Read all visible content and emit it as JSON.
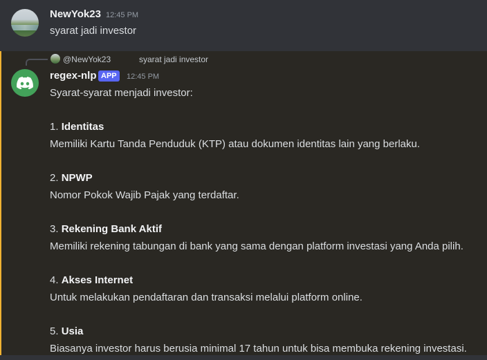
{
  "message1": {
    "username": "NewYok23",
    "timestamp": "12:45 PM",
    "text": "syarat jadi investor"
  },
  "message2": {
    "reply": {
      "username": "@NewYok23",
      "text": "syarat jadi investor"
    },
    "username": "regex-nlp",
    "badge": "APP",
    "timestamp": "12:45 PM",
    "intro": "Syarat-syarat menjadi investor:",
    "items": [
      {
        "number": "1.",
        "title": "Identitas",
        "desc": "Memiliki Kartu Tanda Penduduk (KTP) atau dokumen identitas lain yang berlaku."
      },
      {
        "number": "2.",
        "title": "NPWP",
        "desc": "Nomor Pokok Wajib Pajak yang terdaftar."
      },
      {
        "number": "3.",
        "title": "Rekening Bank Aktif",
        "desc": "Memiliki rekening tabungan di bank yang sama dengan platform investasi yang Anda pilih."
      },
      {
        "number": "4.",
        "title": "Akses Internet",
        "desc": "Untuk melakukan pendaftaran dan transaksi melalui platform online."
      },
      {
        "number": "5.",
        "title": "Usia",
        "desc": "Biasanya investor harus berusia minimal 17 tahun untuk bisa membuka rekening investasi."
      }
    ]
  },
  "colors": {
    "background": "#313338",
    "highlight_background": "#2a2823",
    "mention_bar": "#f0b232",
    "app_badge": "#5865f2",
    "bot_avatar": "#43a25a"
  }
}
